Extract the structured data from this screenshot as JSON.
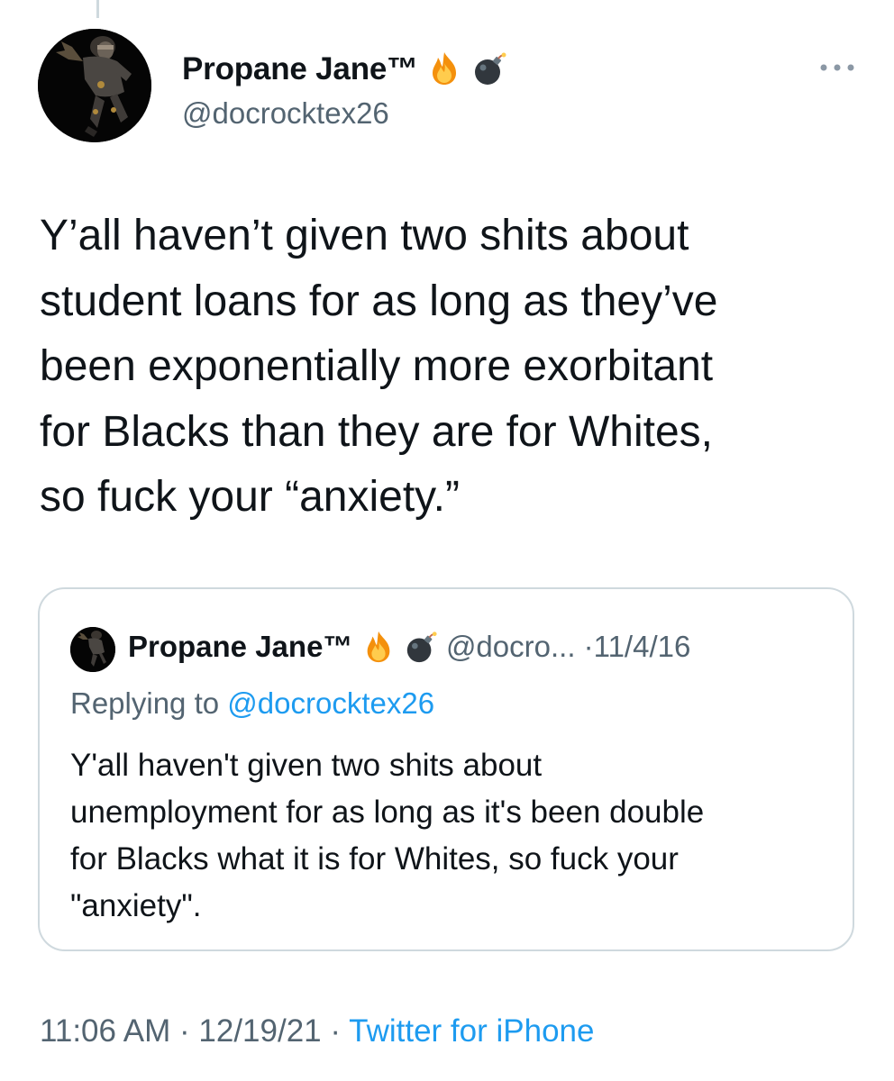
{
  "tweet": {
    "author": {
      "display_name": "Propane Jane™",
      "handle": "@docrocktex26",
      "badge_emojis": [
        "fire-emoji",
        "bomb-emoji"
      ]
    },
    "text": "Y’all haven’t given two shits about\nstudent loans for as long as they’ve\nbeen exponentially more exorbitant\nfor Blacks than they are for Whites,\nso fuck your “anxiety.”",
    "time": "11:06 AM",
    "date": "12/19/21",
    "source": "Twitter for iPhone",
    "separator": "·"
  },
  "quoted_tweet": {
    "display_name": "Propane Jane™",
    "handle_truncated": "@docro...",
    "date": "11/4/16",
    "separator": "·",
    "replying_prefix": "Replying to",
    "replying_to": "@docrocktex26",
    "text": "Y'all haven't given two shits about\nunemployment for as long as it's been double\nfor Blacks what it is for Whites, so fuck your\n\"anxiety\"."
  },
  "icons": {
    "more": "more-horizontal-icon",
    "avatar": "avatar-image"
  },
  "colors": {
    "text_primary": "#0f1419",
    "text_secondary": "#536471",
    "link": "#1d9bf0",
    "border": "#cfd9de"
  }
}
